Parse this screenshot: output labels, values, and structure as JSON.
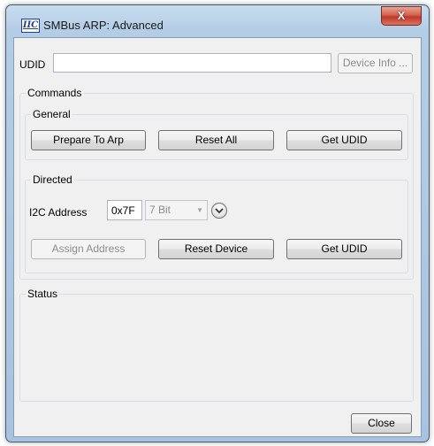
{
  "window": {
    "title": "SMBus ARP: Advanced",
    "app_icon_text": "IIC",
    "close_glyph": "X"
  },
  "udid": {
    "label": "UDID",
    "value": "",
    "device_info_label": "Device Info ..."
  },
  "commands": {
    "title": "Commands",
    "general": {
      "title": "General",
      "prepare_label": "Prepare To Arp",
      "reset_all_label": "Reset All",
      "get_udid_label": "Get UDID"
    },
    "directed": {
      "title": "Directed",
      "address_label": "I2C Address",
      "address_value": "0x7F",
      "bit_mode_selected": "7 Bit",
      "assign_label": "Assign Address",
      "reset_device_label": "Reset Device",
      "get_udid_label": "Get UDID"
    }
  },
  "status": {
    "title": "Status",
    "text": ""
  },
  "footer": {
    "close_label": "Close"
  },
  "icons": {
    "app": "iic-logo-icon",
    "close": "close-icon",
    "expand": "chevron-down-icon",
    "dropdown": "dropdown-arrow-icon"
  },
  "colors": {
    "title_bar": "#b4cde6",
    "close_button": "#c0392b",
    "client_bg": "#f0f0f0"
  }
}
